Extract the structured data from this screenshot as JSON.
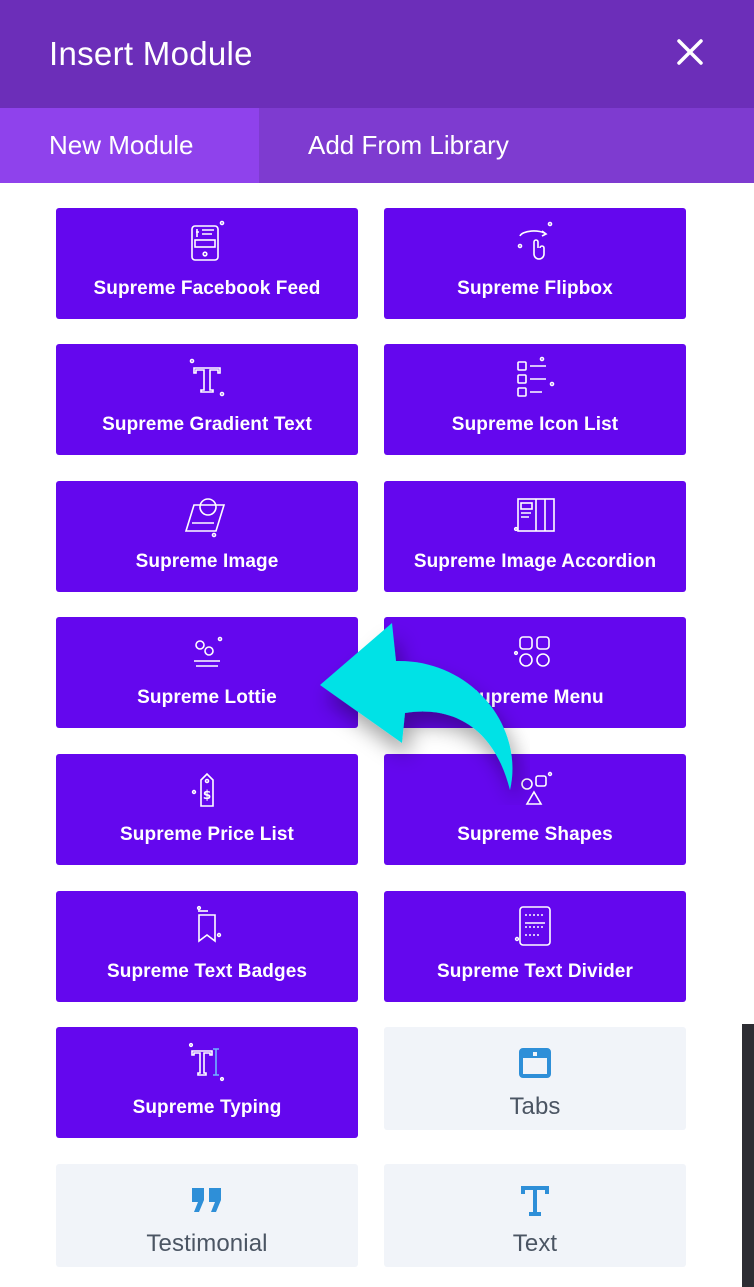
{
  "header": {
    "title": "Insert Module",
    "close_icon": "close-icon"
  },
  "tabs": [
    {
      "label": "New Module",
      "active": true
    },
    {
      "label": "Add From Library",
      "active": false
    }
  ],
  "modules": [
    {
      "label": "Supreme Facebook Feed",
      "icon": "facebook-feed-icon",
      "style": "purple"
    },
    {
      "label": "Supreme Flipbox",
      "icon": "flipbox-icon",
      "style": "purple"
    },
    {
      "label": "Supreme Gradient Text",
      "icon": "gradient-text-icon",
      "style": "purple"
    },
    {
      "label": "Supreme Icon List",
      "icon": "icon-list-icon",
      "style": "purple"
    },
    {
      "label": "Supreme Image",
      "icon": "image-icon",
      "style": "purple"
    },
    {
      "label": "Supreme Image Accordion",
      "icon": "image-accordion-icon",
      "style": "purple"
    },
    {
      "label": "Supreme Lottie",
      "icon": "lottie-icon",
      "style": "purple"
    },
    {
      "label": "Supreme Menu",
      "icon": "menu-icon",
      "style": "purple"
    },
    {
      "label": "Supreme Price List",
      "icon": "price-list-icon",
      "style": "purple"
    },
    {
      "label": "Supreme Shapes",
      "icon": "shapes-icon",
      "style": "purple"
    },
    {
      "label": "Supreme Text Badges",
      "icon": "text-badges-icon",
      "style": "purple"
    },
    {
      "label": "Supreme Text Divider",
      "icon": "text-divider-icon",
      "style": "purple"
    },
    {
      "label": "Supreme Typing",
      "icon": "typing-icon",
      "style": "purple"
    },
    {
      "label": "Tabs",
      "icon": "tabs-icon",
      "style": "light"
    },
    {
      "label": "Testimonial",
      "icon": "quote-icon",
      "style": "light"
    },
    {
      "label": "Text",
      "icon": "text-icon",
      "style": "light"
    }
  ],
  "colors": {
    "header": "#6c2eb9",
    "tab_bar": "#7e3bd0",
    "tab_active": "#8f42ec",
    "module_purple": "#6407ee",
    "module_light": "#f1f4f9",
    "accent_blue": "#2e8fd8",
    "arrow": "#00e2e6"
  }
}
